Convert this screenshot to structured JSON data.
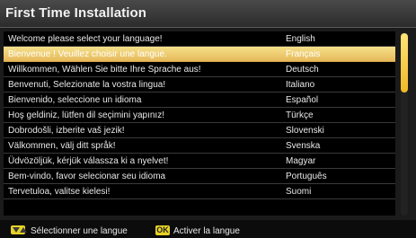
{
  "window": {
    "title": "First Time Installation"
  },
  "languages": [
    {
      "prompt": "Welcome please select your language!",
      "language": "English"
    },
    {
      "prompt": "Bienvenue ! Veuillez choisir une langue.",
      "language": "Français"
    },
    {
      "prompt": "Willkommen, Wählen Sie bitte Ihre Sprache aus!",
      "language": "Deutsch"
    },
    {
      "prompt": "Benvenuti, Selezionate la vostra lingua!",
      "language": "Italiano"
    },
    {
      "prompt": "Bienvenido, seleccione un idioma",
      "language": "Español"
    },
    {
      "prompt": "Hoş geldiniz, lütfen dil seçimini yapınız!",
      "language": "Türkçe"
    },
    {
      "prompt": "Dobrodošli, izberite vaš jezik!",
      "language": "Slovenski"
    },
    {
      "prompt": "Välkommen, välj ditt språk!",
      "language": "Svenska"
    },
    {
      "prompt": "Üdvözöljük, kérjük válassza ki a nyelvet!",
      "language": "Magyar"
    },
    {
      "prompt": "Bem-vindo, favor selecionar seu idioma",
      "language": "Português"
    },
    {
      "prompt": "Tervetuloa, valitse kielesi!",
      "language": "Suomi"
    },
    {
      "prompt": "",
      "language": ""
    }
  ],
  "selected_language": "Français",
  "footer": {
    "navigate_label": "Sélectionner une langue",
    "ok_key": "OK",
    "ok_label": "Activer la langue"
  },
  "colors": {
    "highlight": "#e6b95a",
    "key_yellow": "#e7d224"
  },
  "scroll": {
    "position_fraction": 0.0
  }
}
